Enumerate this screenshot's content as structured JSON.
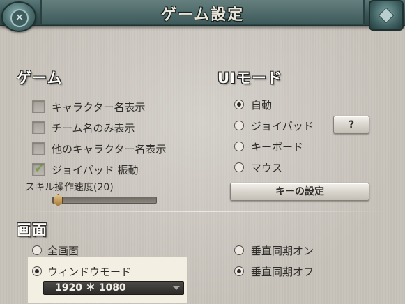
{
  "window": {
    "title": "ゲーム設定"
  },
  "game": {
    "heading": "ゲーム",
    "options": [
      {
        "label": "キャラクター名表示",
        "checked": false
      },
      {
        "label": "チーム名のみ表示",
        "checked": false
      },
      {
        "label": "他のキャラクター名表示",
        "checked": false
      },
      {
        "label": "ジョイパッド 振動",
        "checked": true
      }
    ],
    "skill_speed_label": "スキル操作速度(20)",
    "skill_speed_value": 20,
    "skill_speed_fraction": 0.05
  },
  "ui_mode": {
    "heading": "UIモード",
    "options": [
      {
        "label": "自動",
        "selected": true
      },
      {
        "label": "ジョイパッド",
        "selected": false
      },
      {
        "label": "キーボード",
        "selected": false
      },
      {
        "label": "マウス",
        "selected": false
      }
    ],
    "help_label": "?",
    "key_settings_label": "キーの設定"
  },
  "screen": {
    "heading": "画面",
    "display_options": [
      {
        "label": "全画面",
        "selected": false
      },
      {
        "label": "ウィンドウモード",
        "selected": true
      }
    ],
    "resolution": "1920 ＊ 1080",
    "vsync_options": [
      {
        "label": "垂直同期オン",
        "selected": false
      },
      {
        "label": "垂直同期オフ",
        "selected": true
      }
    ]
  },
  "icons": {
    "close": "close-icon",
    "check": "checkmark-icon",
    "dropdown": "chevron-down-icon"
  },
  "colors": {
    "banner": "#3e5a5a",
    "check": "#79a43d",
    "panel": "#c7c2ba"
  }
}
